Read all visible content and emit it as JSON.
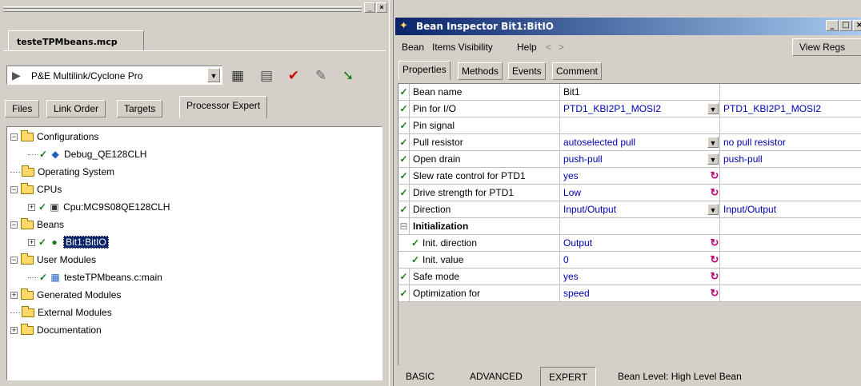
{
  "left": {
    "project_tab": "testeTPMbeans.mcp",
    "target_combo": {
      "value": "P&E Multilink/Cyclone Pro"
    },
    "tabs": [
      "Files",
      "Link Order",
      "Targets",
      "Processor Expert"
    ],
    "active_tab": "Processor Expert",
    "tree": [
      {
        "label": "Configurations",
        "expander": "-",
        "folder": true
      },
      {
        "label": "Debug_QE128CLH",
        "check": "✓",
        "icon": "debug-config-icon"
      },
      {
        "label": "Operating System",
        "folder": true
      },
      {
        "label": "CPUs",
        "expander": "-",
        "folder": true
      },
      {
        "label": "Cpu:MC9S08QE128CLH",
        "expander": "+",
        "check": "✓",
        "icon": "cpu-icon"
      },
      {
        "label": "Beans",
        "expander": "-",
        "folder": true
      },
      {
        "label": "Bit1:BitIO",
        "expander": "+",
        "check": "✓",
        "icon": "bean-icon",
        "selected": true
      },
      {
        "label": "User Modules",
        "expander": "-",
        "folder": true
      },
      {
        "label": "testeTPMbeans.c:main",
        "check": "✓",
        "icon": "module-icon"
      },
      {
        "label": "Generated Modules",
        "expander": "+",
        "folder": true
      },
      {
        "label": "External Modules",
        "folder": true
      },
      {
        "label": "Documentation",
        "expander": "+",
        "folder": true
      }
    ]
  },
  "inspector": {
    "title": "Bean Inspector Bit1:BitIO",
    "menu": [
      "Bean",
      "Items Visibility",
      "Help",
      "<",
      ">"
    ],
    "view_regs": "View Regs",
    "tabs": [
      "Properties",
      "Methods",
      "Events",
      "Comment"
    ],
    "active_tab": "Properties",
    "properties": [
      {
        "check": "✓",
        "name": "Bean name",
        "value": "Bit1",
        "result": ""
      },
      {
        "check": "✓",
        "name": "Pin for I/O",
        "value": "PTD1_KBI2P1_MOSI2",
        "result": "PTD1_KBI2P1_MOSI2",
        "control": "dropdown"
      },
      {
        "check": "✓",
        "name": "Pin signal",
        "value": "",
        "result": ""
      },
      {
        "check": "✓",
        "name": "Pull resistor",
        "value": "autoselected pull",
        "result": "no pull resistor",
        "control": "dropdown"
      },
      {
        "check": "✓",
        "name": "Open drain",
        "value": "push-pull",
        "result": "push-pull",
        "control": "dropdown"
      },
      {
        "check": "✓",
        "name": "Slew rate control for PTD1",
        "value": "yes",
        "result": "",
        "control": "toggle"
      },
      {
        "check": "✓",
        "name": "Drive strength for PTD1",
        "value": "Low",
        "result": "",
        "control": "toggle"
      },
      {
        "check": "✓",
        "name": "Direction",
        "value": "Input/Output",
        "result": "Input/Output",
        "control": "dropdown"
      },
      {
        "check": "⊟",
        "name": "Initialization",
        "value": "",
        "result": "",
        "group": true
      },
      {
        "check": "✓",
        "name": "Init. direction",
        "value": "Output",
        "result": "",
        "control": "toggle",
        "indent": true
      },
      {
        "check": "✓",
        "name": "Init. value",
        "value": "0",
        "result": "",
        "control": "toggle",
        "indent": true
      },
      {
        "check": "✓",
        "name": "Safe mode",
        "value": "yes",
        "result": "",
        "control": "toggle"
      },
      {
        "check": "✓",
        "name": "Optimization for",
        "value": "speed",
        "result": "",
        "control": "toggle"
      }
    ],
    "bottom_tabs": [
      "BASIC",
      "ADVANCED",
      "EXPERT"
    ],
    "active_bottom_tab": "EXPERT",
    "bean_level": "Bean Level: High Level Bean"
  }
}
